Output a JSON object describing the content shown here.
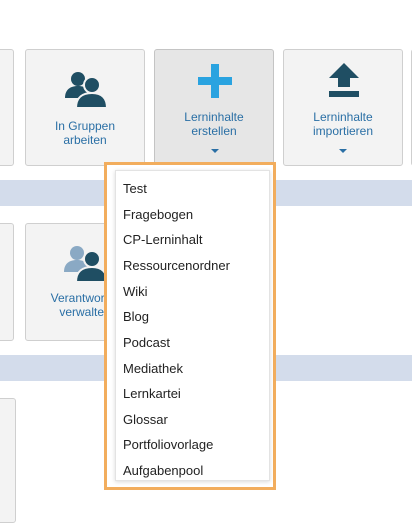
{
  "tiles": {
    "gruppen": {
      "label": "In Gruppen arbeiten",
      "line1": "In Gruppen",
      "line2": "arbeiten",
      "icon": "users-icon"
    },
    "erstellen": {
      "label": "Lerninhalte erstellen",
      "line1": "Lerninhalte",
      "line2": "erstellen",
      "icon": "plus-icon"
    },
    "importieren": {
      "label": "Lerninhalte importieren",
      "line1": "Lerninhalte",
      "line2": "importieren",
      "icon": "upload-icon"
    },
    "verantwortlich": {
      "line1": "Verantwortlic",
      "line2": "verwalten",
      "icon": "responsible-users-icon"
    }
  },
  "dropdown": {
    "items": [
      "Test",
      "Fragebogen",
      "CP-Lerninhalt",
      "Ressourcenordner",
      "Wiki",
      "Blog",
      "Podcast",
      "Mediathek",
      "Lernkartei",
      "Glossar",
      "Portfoliovorlage",
      "Aufgabenpool"
    ]
  },
  "colors": {
    "accent": "#2a6fa5",
    "icon_teal": "#1f4e63",
    "plus_cyan": "#2aa3e0",
    "band": "#d3dceb",
    "highlight_border": "#f2ad5d"
  }
}
